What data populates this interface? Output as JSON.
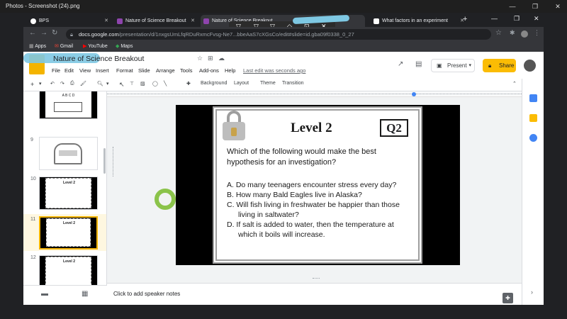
{
  "photos_app": {
    "title": "Photos - Screenshot (24).png"
  },
  "browser": {
    "tabs": [
      {
        "label": "BPS",
        "active": false
      },
      {
        "label": "Nature of Science Breakout",
        "active": false
      },
      {
        "label": "Nature of Science Breakout",
        "active": true
      },
      {
        "label": "What factors in an experiment",
        "active": false
      }
    ],
    "url_host": "docs.google.com",
    "url_path": "/presentation/d/1nxgsUmLfqRDuRxmcFvsg-Ne7...bbeAaS7cXGsCo/edit#slide=id.gba09f0338_0_27",
    "bookmarks": [
      {
        "label": "Apps",
        "icon": "apps-grid-icon"
      },
      {
        "label": "Gmail",
        "icon": "gmail-icon"
      },
      {
        "label": "YouTube",
        "icon": "youtube-icon"
      },
      {
        "label": "Maps",
        "icon": "maps-icon"
      }
    ]
  },
  "docs": {
    "title": "Nature of Science Breakout",
    "menus": [
      "File",
      "Edit",
      "View",
      "Insert",
      "Format",
      "Slide",
      "Arrange",
      "Tools",
      "Add-ons",
      "Help"
    ],
    "last_edit": "Last edit was seconds ago",
    "present_label": "Present",
    "share_label": "Share",
    "toolbar_labels": {
      "background": "Background",
      "layout": "Layout",
      "theme": "Theme",
      "transition": "Transition"
    },
    "notes_placeholder": "Click to add speaker notes"
  },
  "filmstrip": {
    "slide_numbers": [
      "9",
      "10",
      "11",
      "12",
      "13"
    ],
    "selected": "11",
    "thumb_title": "Level 2",
    "thumb_top_letters": "A B C D"
  },
  "slide": {
    "level": "Level 2",
    "question_id": "Q2",
    "question": "Which of the following would make the best hypothesis for an investigation?",
    "options": [
      "A. Do many teenagers encounter stress every day?",
      "B. How many Bald Eagles live in Alaska?",
      "C. Will fish living in freshwater be happier than those living in saltwater?",
      "D. If salt is added to water, then the temperature at which it boils will increase."
    ]
  },
  "colors": {
    "share": "#fbbc04",
    "selected_thumb": "#f4b400",
    "ring": "#8bc34a"
  }
}
